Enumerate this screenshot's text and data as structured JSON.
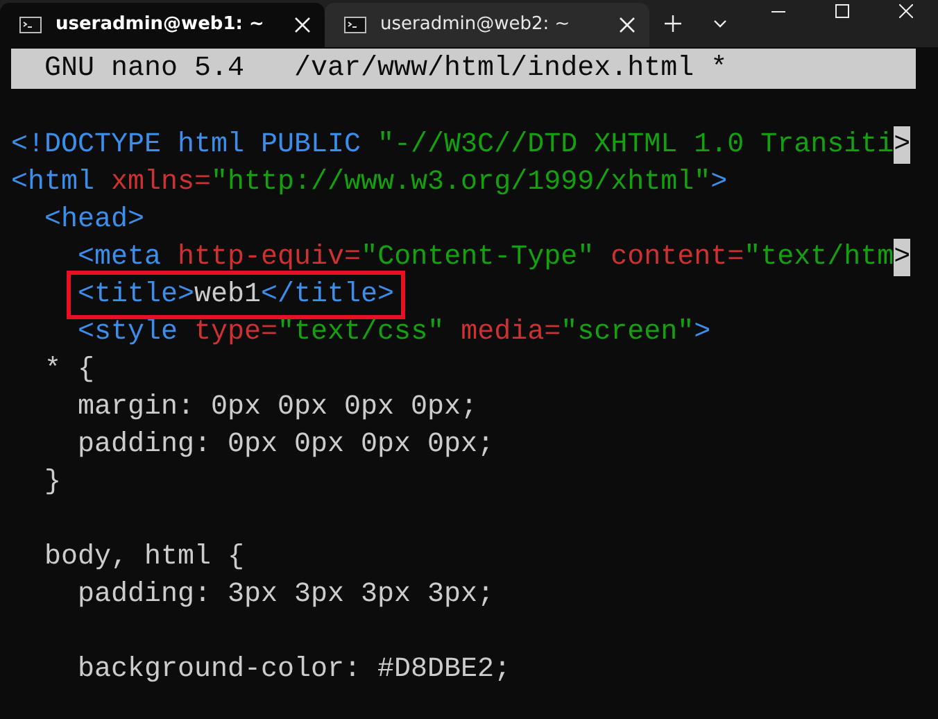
{
  "tabs": [
    {
      "title": "useradmin@web1: ~",
      "selected": true
    },
    {
      "title": "useradmin@web2: ~",
      "selected": false
    }
  ],
  "editor": {
    "header": {
      "app": "GNU nano 5.4",
      "file": "/var/www/html/index.html",
      "modified": "*"
    },
    "lines": [
      {
        "kind": "code",
        "annotated": false,
        "tokens": [
          {
            "kind": "tag",
            "text": "<!DOCTYPE html PUBLIC "
          },
          {
            "kind": "string",
            "text": "\"-//W3C//DTD XHTML 1.0 Transiti"
          },
          {
            "kind": "more",
            "text": ">"
          }
        ]
      },
      {
        "kind": "code",
        "annotated": false,
        "tokens": [
          {
            "kind": "tag",
            "text": "<html "
          },
          {
            "kind": "attr",
            "text": "xmlns="
          },
          {
            "kind": "string",
            "text": "\"http://www.w3.org/1999/xhtml\""
          },
          {
            "kind": "tag",
            "text": ">"
          }
        ]
      },
      {
        "kind": "code",
        "annotated": false,
        "tokens": [
          {
            "kind": "tag",
            "text": "  <head>"
          }
        ]
      },
      {
        "kind": "code",
        "annotated": false,
        "tokens": [
          {
            "kind": "tag",
            "text": "    <meta "
          },
          {
            "kind": "attr",
            "text": "http-equiv="
          },
          {
            "kind": "string",
            "text": "\"Content-Type\" "
          },
          {
            "kind": "attr",
            "text": "content="
          },
          {
            "kind": "string",
            "text": "\"text/htm"
          },
          {
            "kind": "more",
            "text": ">"
          }
        ]
      },
      {
        "kind": "code",
        "annotated": true,
        "tokens": [
          {
            "kind": "tag",
            "text": "    <title>"
          },
          {
            "kind": "plain",
            "text": "web1"
          },
          {
            "kind": "tag",
            "text": "</title>"
          }
        ]
      },
      {
        "kind": "code",
        "annotated": false,
        "tokens": [
          {
            "kind": "tag",
            "text": "    <style "
          },
          {
            "kind": "attr",
            "text": "type="
          },
          {
            "kind": "string",
            "text": "\"text/css\" "
          },
          {
            "kind": "attr",
            "text": "media="
          },
          {
            "kind": "string",
            "text": "\"screen\""
          },
          {
            "kind": "tag",
            "text": ">"
          }
        ]
      },
      {
        "kind": "code",
        "annotated": false,
        "tokens": [
          {
            "kind": "plain",
            "text": "  * {"
          }
        ]
      },
      {
        "kind": "code",
        "annotated": false,
        "tokens": [
          {
            "kind": "plain",
            "text": "    margin: 0px 0px 0px 0px;"
          }
        ]
      },
      {
        "kind": "code",
        "annotated": false,
        "tokens": [
          {
            "kind": "plain",
            "text": "    padding: 0px 0px 0px 0px;"
          }
        ]
      },
      {
        "kind": "code",
        "annotated": false,
        "tokens": [
          {
            "kind": "plain",
            "text": "  }"
          }
        ]
      },
      {
        "kind": "blank"
      },
      {
        "kind": "code",
        "annotated": false,
        "tokens": [
          {
            "kind": "plain",
            "text": "  body, html {"
          }
        ]
      },
      {
        "kind": "code",
        "annotated": false,
        "tokens": [
          {
            "kind": "plain",
            "text": "    padding: 3px 3px 3px 3px;"
          }
        ]
      },
      {
        "kind": "blank"
      },
      {
        "kind": "code",
        "annotated": false,
        "tokens": [
          {
            "kind": "plain",
            "text": "    background-color: #D8DBE2;"
          }
        ]
      }
    ]
  }
}
